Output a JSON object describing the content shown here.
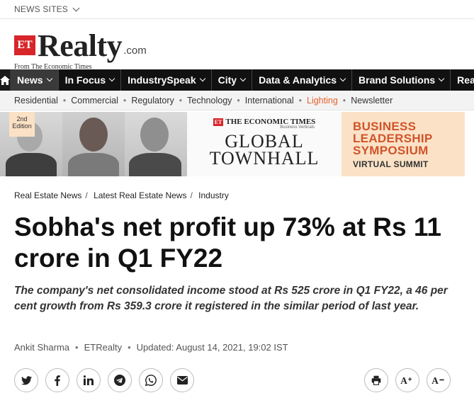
{
  "top_bar": {
    "news_sites_label": "NEWS SITES"
  },
  "logo": {
    "et": "ET",
    "word": "Realty",
    "domain": ".com",
    "tagline": "From The Economic Times"
  },
  "main_nav": [
    {
      "label": "News",
      "active": true
    },
    {
      "label": "In Focus"
    },
    {
      "label": "IndustrySpeak"
    },
    {
      "label": "City"
    },
    {
      "label": "Data & Analytics"
    },
    {
      "label": "Brand Solutions"
    },
    {
      "label": "Realty"
    }
  ],
  "sub_nav": [
    "Residential",
    "Commercial",
    "Regulatory",
    "Technology",
    "International",
    "Lighting",
    "Newsletter"
  ],
  "sub_nav_highlight": "Lighting",
  "banner": {
    "edition_line1": "2nd",
    "edition_line2": "Edition",
    "et_header": "THE ECONOMIC TIMES",
    "business_verticals": "Business Verticals",
    "event_line1": "GLOBAL",
    "event_line2": "TOWNHALL",
    "symposium_line1": "BUSINESS",
    "symposium_line2": "LEADERSHIP",
    "symposium_line3": "SYMPOSIUM",
    "symposium_sub": "VIRTUAL SUMMIT"
  },
  "breadcrumb": [
    "Real Estate News",
    "Latest Real Estate News",
    "Industry"
  ],
  "article": {
    "title": "Sobha's net profit up 73% at Rs 11 crore in Q1 FY22",
    "synopsis": "The company's net consolidated income stood at Rs 525 crore in Q1 FY22, a 46 per cent growth from Rs 359.3 crore it registered in the similar period of last year.",
    "author": "Ankit Sharma",
    "source": "ETRealty",
    "updated": "Updated: August 14, 2021, 19:02 IST"
  },
  "share_icons": [
    "twitter-icon",
    "facebook-icon",
    "linkedin-icon",
    "telegram-icon",
    "whatsapp-icon",
    "email-icon"
  ],
  "tool_icons": [
    "print-icon",
    "font-increase-icon",
    "font-decrease-icon"
  ],
  "colors": {
    "nav_bg": "#111111",
    "accent": "#d7252a",
    "highlight": "#e8612c",
    "symposium_bg": "#fbe2c7"
  }
}
